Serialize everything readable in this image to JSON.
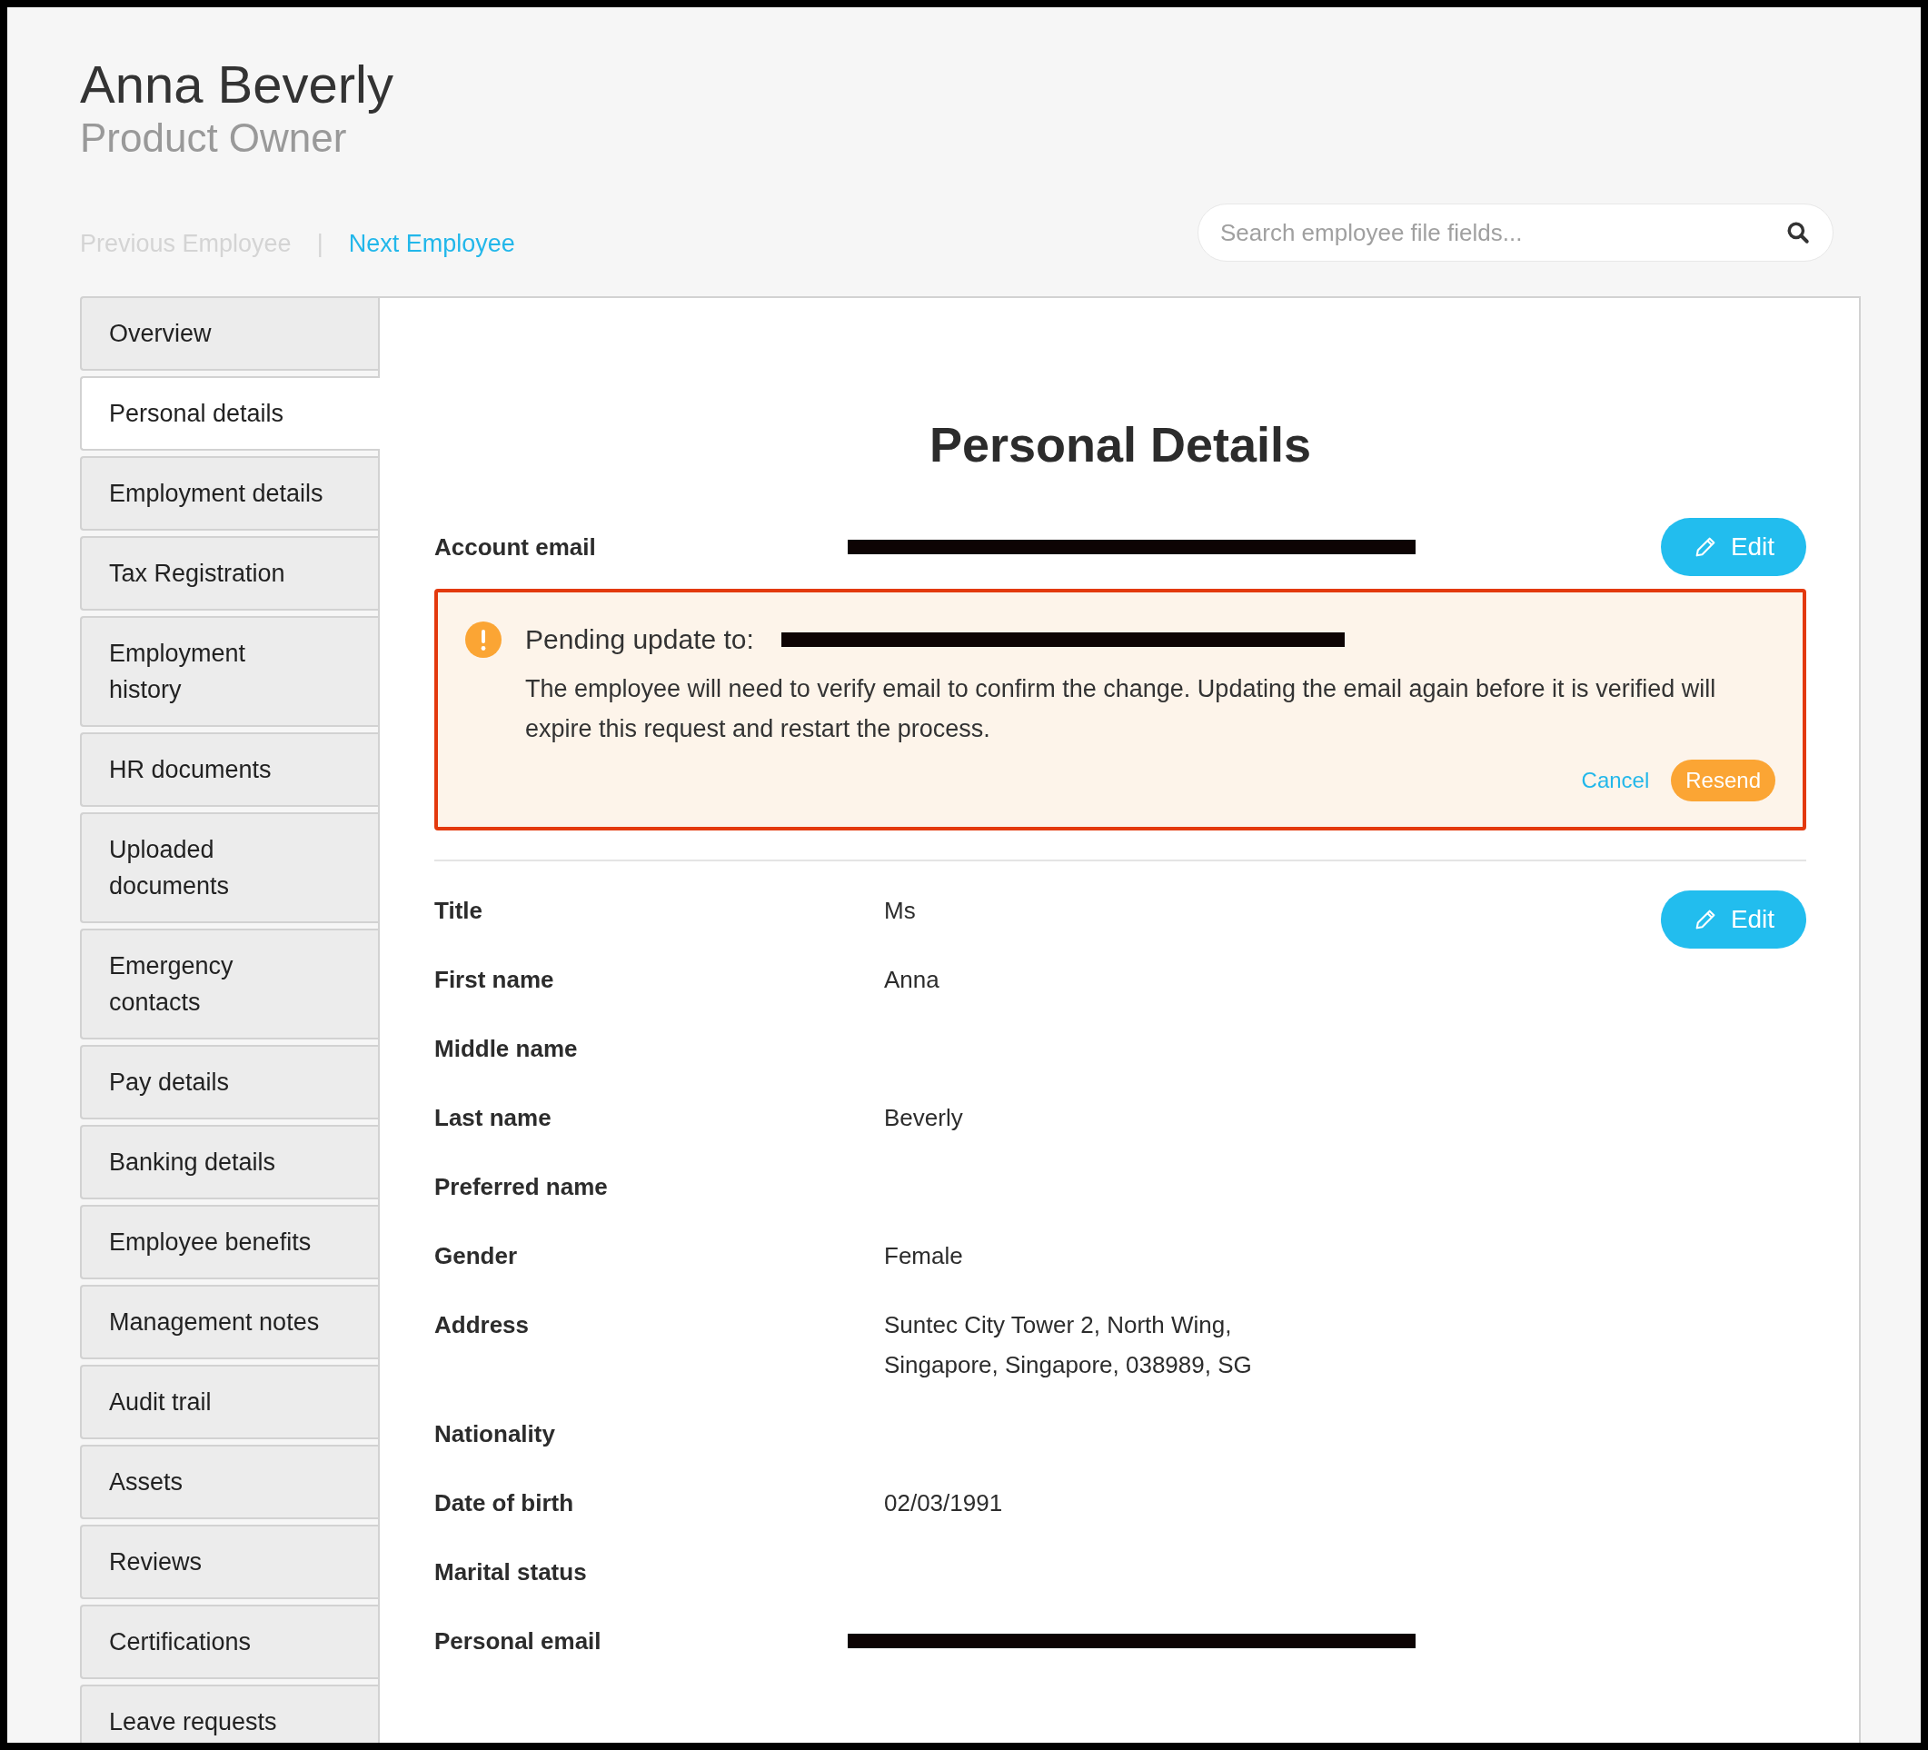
{
  "header": {
    "name": "Anna Beverly",
    "role": "Product Owner"
  },
  "nav": [
    {
      "label": "Previous Employee",
      "disabled": true
    },
    {
      "label": "Next Employee",
      "disabled": false
    }
  ],
  "nav_separator": "|",
  "search": {
    "placeholder": "Search employee file fields..."
  },
  "sidebar": {
    "items": [
      {
        "label": "Overview",
        "selected": false
      },
      {
        "label": "Personal details",
        "selected": true
      },
      {
        "label": "Employment details",
        "selected": false
      },
      {
        "label": "Tax Registration",
        "selected": false
      },
      {
        "label": "Employment history",
        "selected": false
      },
      {
        "label": "HR documents",
        "selected": false
      },
      {
        "label": "Uploaded documents",
        "selected": false
      },
      {
        "label": "Emergency contacts",
        "selected": false
      },
      {
        "label": "Pay details",
        "selected": false
      },
      {
        "label": "Banking details",
        "selected": false
      },
      {
        "label": "Employee benefits",
        "selected": false
      },
      {
        "label": "Management notes",
        "selected": false
      },
      {
        "label": "Audit trail",
        "selected": false
      },
      {
        "label": "Assets",
        "selected": false
      },
      {
        "label": "Reviews",
        "selected": false
      },
      {
        "label": "Certifications",
        "selected": false
      },
      {
        "label": "Leave requests",
        "selected": false
      }
    ]
  },
  "title": "Personal Details",
  "account": {
    "label": "Account email",
    "value": {
      "kind": "redacted"
    },
    "edit": "Edit"
  },
  "pending": {
    "heading": "Pending update to:",
    "value": {
      "kind": "redacted"
    },
    "message": "The employee will need to verify email to confirm the change. Updating the email again before it is verified will expire this request and restart the process.",
    "cancel": "Cancel",
    "resend": "Resend"
  },
  "details": {
    "edit": "Edit",
    "fields": [
      {
        "label": "Title",
        "kind": "text",
        "value": "Ms"
      },
      {
        "label": "First name",
        "kind": "text",
        "value": "Anna"
      },
      {
        "label": "Middle name",
        "kind": "empty"
      },
      {
        "label": "Last name",
        "kind": "text",
        "value": "Beverly"
      },
      {
        "label": "Preferred name",
        "kind": "empty"
      },
      {
        "label": "Gender",
        "kind": "text",
        "value": "Female"
      },
      {
        "label": "Address",
        "kind": "lines",
        "lines": [
          "Suntec City Tower 2, North Wing,",
          "Singapore, Singapore, 038989, SG"
        ]
      },
      {
        "label": "Nationality",
        "kind": "empty"
      },
      {
        "label": "Date of birth",
        "kind": "text",
        "value": "02/03/1991"
      },
      {
        "label": "Marital status",
        "kind": "empty"
      },
      {
        "label": "Personal email",
        "kind": "redacted"
      }
    ]
  }
}
